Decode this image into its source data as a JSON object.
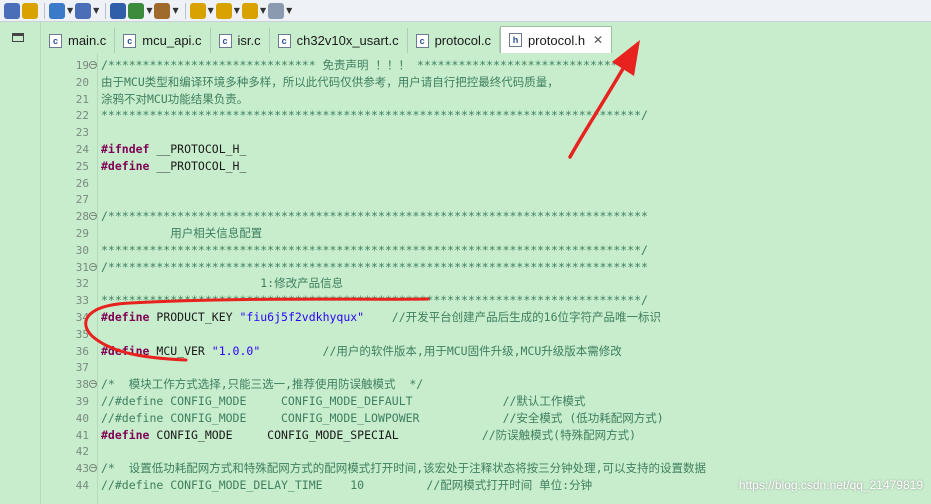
{
  "toolbar": {
    "items": [
      {
        "icon": "new-file-icon",
        "dropdown": false
      },
      {
        "icon": "open-project-icon",
        "dropdown": false
      },
      {
        "icon": "build-config-icon",
        "dropdown": true
      },
      {
        "icon": "print-icon",
        "dropdown": true
      },
      {
        "icon": "load-icon",
        "dropdown": false
      },
      {
        "icon": "debug-icon",
        "dropdown": true
      },
      {
        "icon": "tools-icon",
        "dropdown": true
      },
      {
        "icon": "next-annotation-icon",
        "dropdown": true
      },
      {
        "icon": "prev-annotation-icon",
        "dropdown": true
      },
      {
        "icon": "back-icon",
        "dropdown": true
      },
      {
        "icon": "forward-icon",
        "dropdown": true
      }
    ],
    "dropdown_glyph": "▼"
  },
  "tabs": [
    {
      "label": "main.c",
      "active": false
    },
    {
      "label": "mcu_api.c",
      "active": false
    },
    {
      "label": "isr.c",
      "active": false
    },
    {
      "label": "ch32v10x_usart.c",
      "active": false
    },
    {
      "label": "protocol.c",
      "active": false
    },
    {
      "label": "protocol.h",
      "active": true
    }
  ],
  "tab_c_glyph": "c",
  "tab_h_glyph": "h",
  "close_glyph": "✕",
  "lines": [
    {
      "n": "19",
      "fold": true,
      "segs": [
        {
          "t": "cm",
          "v": "/****************************** 免责声明 ！！！ ******************************"
        }
      ]
    },
    {
      "n": "20",
      "segs": [
        {
          "t": "cm",
          "v": "由于MCU类型和编译环境多种多样，所以此代码仅供参考，用户请自行把控最终代码质量，"
        }
      ]
    },
    {
      "n": "21",
      "segs": [
        {
          "t": "cm",
          "v": "涂鸦不对MCU功能结果负责。"
        }
      ]
    },
    {
      "n": "22",
      "segs": [
        {
          "t": "cm",
          "v": "******************************************************************************/"
        }
      ]
    },
    {
      "n": "23",
      "segs": []
    },
    {
      "n": "24",
      "segs": [
        {
          "t": "pp",
          "v": "#ifndef"
        },
        {
          "t": "pl",
          "v": " __PROTOCOL_H_"
        }
      ]
    },
    {
      "n": "25",
      "segs": [
        {
          "t": "pp",
          "v": "#define"
        },
        {
          "t": "pl",
          "v": " __PROTOCOL_H_"
        }
      ]
    },
    {
      "n": "26",
      "segs": []
    },
    {
      "n": "27",
      "segs": []
    },
    {
      "n": "28",
      "fold": true,
      "segs": [
        {
          "t": "cm",
          "v": "/******************************************************************************"
        }
      ]
    },
    {
      "n": "29",
      "segs": [
        {
          "t": "cm",
          "v": "          用户相关信息配置"
        }
      ]
    },
    {
      "n": "30",
      "segs": [
        {
          "t": "cm",
          "v": "******************************************************************************/"
        }
      ]
    },
    {
      "n": "31",
      "fold": true,
      "segs": [
        {
          "t": "cm",
          "v": "/******************************************************************************"
        }
      ]
    },
    {
      "n": "32",
      "segs": [
        {
          "t": "cm",
          "v": "                       1:修改产品信息"
        }
      ]
    },
    {
      "n": "33",
      "segs": [
        {
          "t": "cm",
          "v": "******************************************************************************/"
        }
      ]
    },
    {
      "n": "34",
      "segs": [
        {
          "t": "pp",
          "v": "#define"
        },
        {
          "t": "pl",
          "v": " PRODUCT_KEY "
        },
        {
          "t": "str",
          "v": "\"fiu6j5f2vdkhyqux\""
        },
        {
          "t": "cm",
          "v": "    //开发平台创建产品后生成的16位字符产品唯一标识"
        }
      ]
    },
    {
      "n": "35",
      "segs": []
    },
    {
      "n": "36",
      "segs": [
        {
          "t": "pp",
          "v": "#define"
        },
        {
          "t": "pl",
          "v": " MCU_VER "
        },
        {
          "t": "str",
          "v": "\"1.0.0\""
        },
        {
          "t": "cm",
          "v": "         //用户的软件版本,用于MCU固件升级,MCU升级版本需修改"
        }
      ]
    },
    {
      "n": "37",
      "segs": []
    },
    {
      "n": "38",
      "fold": true,
      "segs": [
        {
          "t": "cm",
          "v": "/*  模块工作方式选择,只能三选一,推荐使用防误触模式  */"
        }
      ]
    },
    {
      "n": "39",
      "segs": [
        {
          "t": "cm",
          "v": "//#define CONFIG_MODE     CONFIG_MODE_DEFAULT             //默认工作模式"
        }
      ]
    },
    {
      "n": "40",
      "segs": [
        {
          "t": "cm",
          "v": "//#define CONFIG_MODE     CONFIG_MODE_LOWPOWER            //安全模式 (低功耗配网方式)"
        }
      ]
    },
    {
      "n": "41",
      "segs": [
        {
          "t": "pp",
          "v": "#define"
        },
        {
          "t": "pl",
          "v": " CONFIG_MODE     CONFIG_MODE_SPECIAL            "
        },
        {
          "t": "cm",
          "v": "//防误触模式(特殊配网方式)"
        }
      ]
    },
    {
      "n": "42",
      "segs": []
    },
    {
      "n": "43",
      "fold": true,
      "segs": [
        {
          "t": "cm",
          "v": "/*  设置低功耗配网方式和特殊配网方式的配网模式打开时间,该宏处于注释状态将按三分钟处理,可以支持的设置数据"
        }
      ]
    },
    {
      "n": "44",
      "segs": [
        {
          "t": "cm",
          "v": "//#define CONFIG_MODE_DELAY_TIME    10         //配网模式打开时间 单位:分钟"
        }
      ]
    }
  ],
  "watermark": "https://blog.csdn.net/qq_21479819"
}
